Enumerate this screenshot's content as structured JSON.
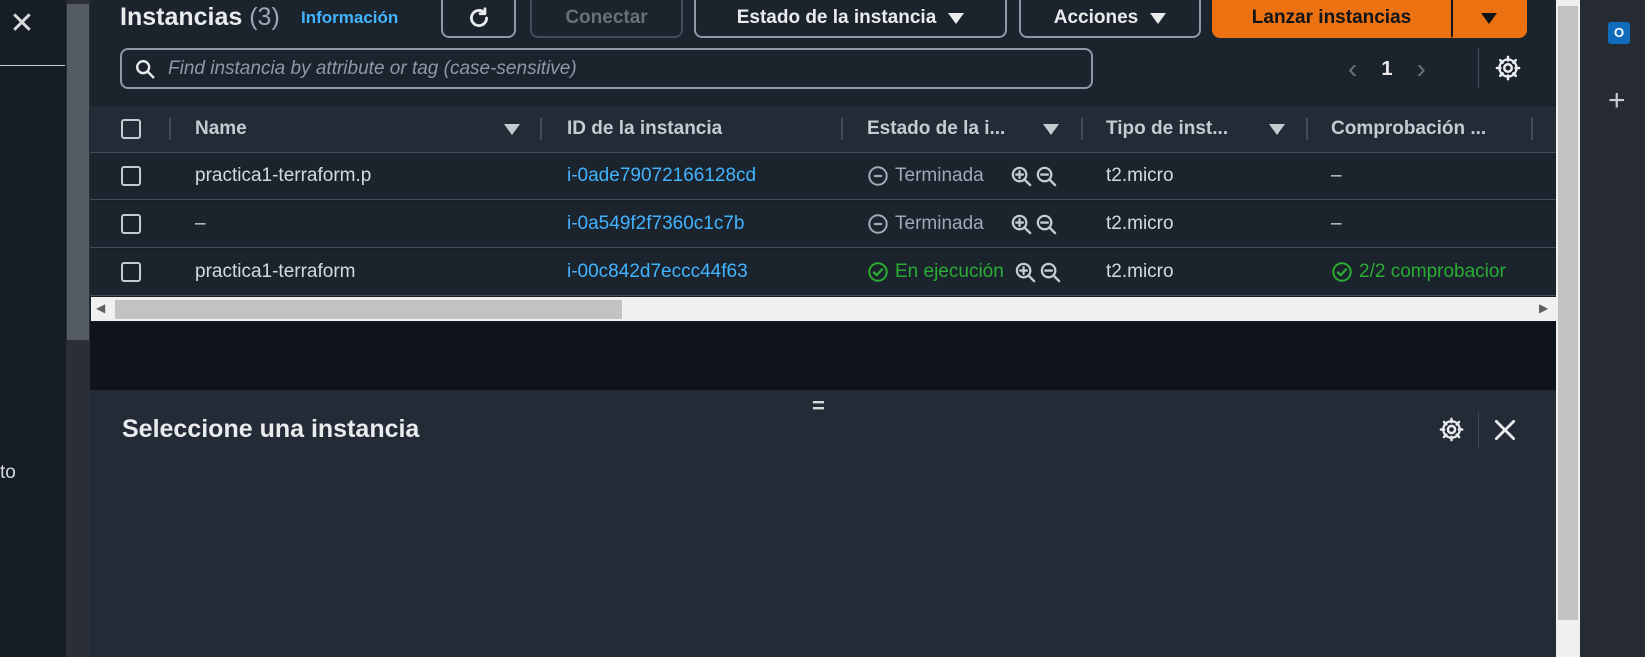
{
  "header": {
    "title": "Instancias",
    "count": "(3)",
    "info_link": "Información",
    "connect_label": "Conectar",
    "instance_state_label": "Estado de la instancia",
    "actions_label": "Acciones",
    "launch_label": "Lanzar instancias",
    "search_placeholder": "Find instancia by attribute or tag (case-sensitive)",
    "page_number": "1"
  },
  "table": {
    "columns": [
      "Name",
      "ID de la instancia",
      "Estado de la i...",
      "Tipo de inst...",
      "Comprobación ..."
    ],
    "rows": [
      {
        "name": "practica1-terraform.p",
        "id": "i-0ade79072166128cd",
        "state": "Terminada",
        "state_kind": "terminated",
        "type": "t2.micro",
        "check": "–"
      },
      {
        "name": "–",
        "id": "i-0a549f2f7360c1c7b",
        "state": "Terminada",
        "state_kind": "terminated",
        "type": "t2.micro",
        "check": "–"
      },
      {
        "name": "practica1-terraform",
        "id": "i-00c842d7eccc44f63",
        "state": "En ejecución",
        "state_kind": "running",
        "type": "t2.micro",
        "check": "2/2 comprobacior"
      }
    ]
  },
  "detail_panel": {
    "title": "Seleccione una instancia",
    "split_handle": "="
  },
  "left_fragment": "to",
  "edge_bar": {
    "outlook_letter": "O"
  },
  "colors": {
    "accent_orange": "#ec7211",
    "link_blue": "#42b4ff",
    "running_green": "#29ad32"
  }
}
